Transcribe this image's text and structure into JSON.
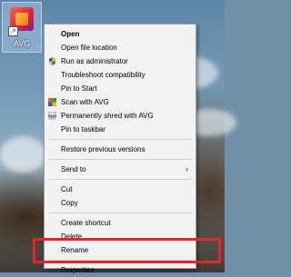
{
  "desktop": {
    "icon": {
      "label": "AVG",
      "icon_name": "avg-app-icon"
    }
  },
  "context_menu": {
    "groups": [
      [
        {
          "label": "Open",
          "bold": true,
          "icon": null
        },
        {
          "label": "Open file location",
          "icon": null
        },
        {
          "label": "Run as administrator",
          "icon": "shield-icon"
        },
        {
          "label": "Troubleshoot compatibility",
          "icon": null
        },
        {
          "label": "Pin to Start",
          "icon": null
        },
        {
          "label": "Scan with AVG",
          "icon": "avg-scan-icon"
        },
        {
          "label": "Permanently shred with AVG",
          "icon": "shredder-icon"
        },
        {
          "label": "Pin to taskbar",
          "icon": null
        }
      ],
      [
        {
          "label": "Restore previous versions",
          "icon": null
        }
      ],
      [
        {
          "label": "Send to",
          "submenu": true,
          "icon": null
        }
      ],
      [
        {
          "label": "Cut",
          "icon": null
        },
        {
          "label": "Copy",
          "icon": null
        }
      ],
      [
        {
          "label": "Create shortcut",
          "icon": null
        },
        {
          "label": "Delete",
          "icon": null
        },
        {
          "label": "Rename",
          "icon": null
        }
      ],
      [
        {
          "label": "Properties",
          "icon": null,
          "highlighted": true
        }
      ]
    ],
    "submenu_arrow": "›"
  },
  "colors": {
    "highlight_border": "#e8232b",
    "menu_background": "#f2f2f2"
  }
}
